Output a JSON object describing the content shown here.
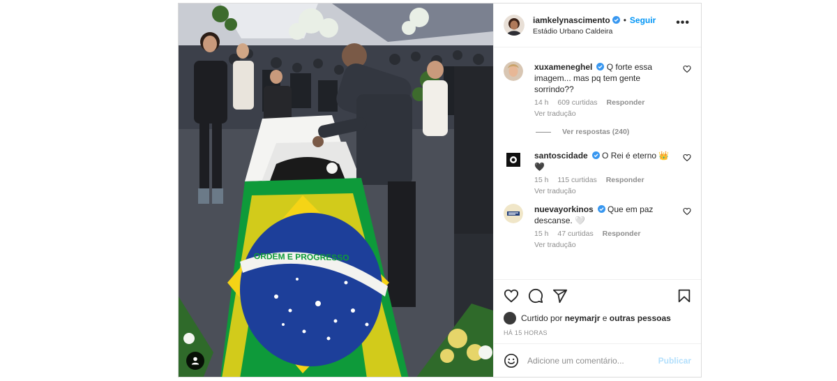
{
  "post": {
    "author": {
      "username": "iamkelynascimento",
      "follow_label": "Seguir",
      "separator": "•",
      "location": "Estádio Urbano Caldeira"
    },
    "more_label": "•••",
    "flag_motto": "ORDEM E PROGRESSO",
    "comments": [
      {
        "username": "xuxameneghel",
        "text": "Q forte essa imagem... mas pq tem gente sorrindo??",
        "time": "14 h",
        "likes": "609 curtidas",
        "reply_label": "Responder",
        "translate_label": "Ver tradução",
        "view_replies": "Ver respostas (240)"
      },
      {
        "username": "santoscidade",
        "text": "O Rei é eterno 👑 🖤",
        "time": "15 h",
        "likes": "115 curtidas",
        "reply_label": "Responder",
        "translate_label": "Ver tradução"
      },
      {
        "username": "nuevayorkinos",
        "text": "Que em paz descanse. 🤍",
        "time": "15 h",
        "likes": "47 curtidas",
        "reply_label": "Responder",
        "translate_label": "Ver tradução"
      }
    ],
    "liked_by": {
      "prefix": "Curtido por",
      "user": "neymarjr",
      "connector": "e",
      "others": "outras pessoas"
    },
    "time_ago": "HÁ 15 HORAS",
    "add_comment": {
      "placeholder": "Adicione um comentário...",
      "publish_label": "Publicar"
    }
  },
  "icons": {
    "verified": "verified-badge-icon",
    "heart": "heart-icon",
    "comment": "comment-icon",
    "share": "paper-plane-icon",
    "save": "bookmark-icon",
    "emoji": "smiley-icon",
    "tag": "user-tag-icon"
  },
  "colors": {
    "accent": "#0095f6",
    "publish_disabled": "#b2dffc",
    "verified": "#3897f0",
    "muted_text": "#8e8e8e",
    "border": "#dbdbdb"
  }
}
